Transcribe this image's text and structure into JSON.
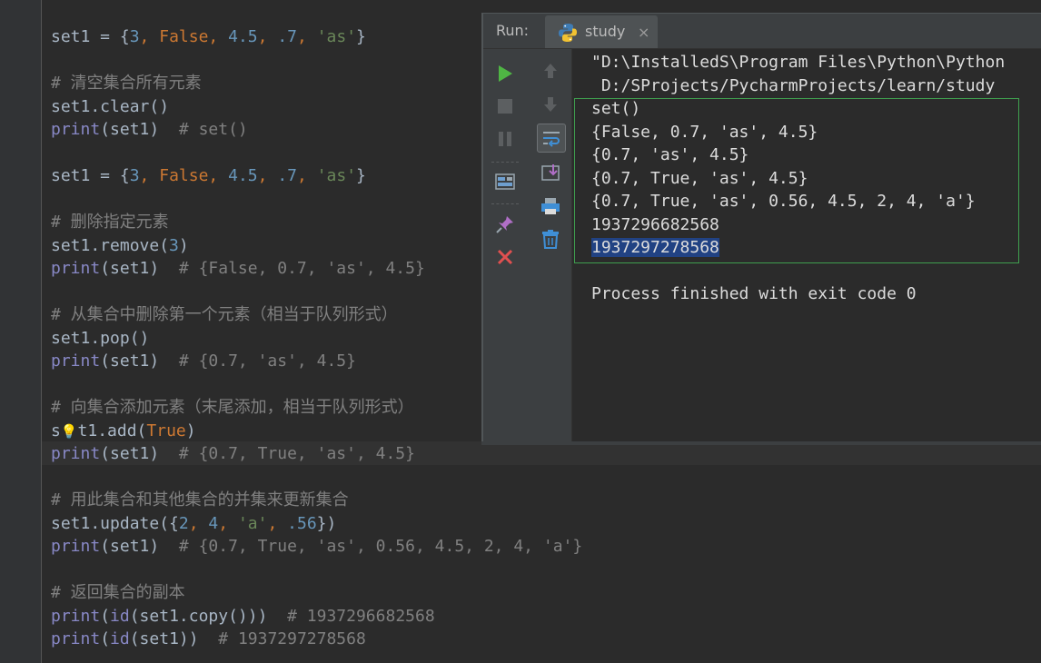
{
  "editor": {
    "lines": [
      [
        {
          "t": "set1 = {",
          "c": ""
        },
        {
          "t": "3",
          "c": "num"
        },
        {
          "t": ", ",
          "c": "kw"
        },
        {
          "t": "False",
          "c": "kw"
        },
        {
          "t": ", ",
          "c": "kw"
        },
        {
          "t": "4.5",
          "c": "num"
        },
        {
          "t": ", ",
          "c": "kw"
        },
        {
          "t": ".7",
          "c": "num"
        },
        {
          "t": ", ",
          "c": "kw"
        },
        {
          "t": "'as'",
          "c": "str"
        },
        {
          "t": "}",
          "c": ""
        }
      ],
      [],
      [
        {
          "t": "# 清空集合所有元素",
          "c": "cm"
        }
      ],
      [
        {
          "t": "set1.clear()",
          "c": ""
        }
      ],
      [
        {
          "t": "print",
          "c": "fn"
        },
        {
          "t": "(set1)  ",
          "c": ""
        },
        {
          "t": "# set()",
          "c": "cm"
        }
      ],
      [],
      [
        {
          "t": "set1 = {",
          "c": ""
        },
        {
          "t": "3",
          "c": "num"
        },
        {
          "t": ", ",
          "c": "kw"
        },
        {
          "t": "False",
          "c": "kw"
        },
        {
          "t": ", ",
          "c": "kw"
        },
        {
          "t": "4.5",
          "c": "num"
        },
        {
          "t": ", ",
          "c": "kw"
        },
        {
          "t": ".7",
          "c": "num"
        },
        {
          "t": ", ",
          "c": "kw"
        },
        {
          "t": "'as'",
          "c": "str"
        },
        {
          "t": "}",
          "c": ""
        }
      ],
      [],
      [
        {
          "t": "# 删除指定元素",
          "c": "cm"
        }
      ],
      [
        {
          "t": "set1.remove(",
          "c": ""
        },
        {
          "t": "3",
          "c": "num"
        },
        {
          "t": ")",
          "c": ""
        }
      ],
      [
        {
          "t": "print",
          "c": "fn"
        },
        {
          "t": "(set1)  ",
          "c": ""
        },
        {
          "t": "# {False, 0.7, 'as', 4.5}",
          "c": "cm"
        }
      ],
      [],
      [
        {
          "t": "# 从集合中删除第一个元素（相当于队列形式）",
          "c": "cm"
        }
      ],
      [
        {
          "t": "set1.pop()",
          "c": ""
        }
      ],
      [
        {
          "t": "print",
          "c": "fn"
        },
        {
          "t": "(set1)  ",
          "c": ""
        },
        {
          "t": "# {0.7, 'as', 4.5}",
          "c": "cm"
        }
      ],
      [],
      [
        {
          "t": "# 向集合添加元素（末尾添加，相当于队列形式）",
          "c": "cm"
        }
      ],
      [
        {
          "t": "s",
          "c": ""
        },
        {
          "t": "💡",
          "c": "bulb"
        },
        {
          "t": "t1.add(",
          "c": ""
        },
        {
          "t": "True",
          "c": "kw"
        },
        {
          "t": ")",
          "c": ""
        }
      ],
      [
        {
          "t": "print",
          "c": "fn"
        },
        {
          "t": "(set1)  ",
          "c": ""
        },
        {
          "t": "# {0.7, True, 'as', 4.5}",
          "c": "cm"
        }
      ],
      [],
      [
        {
          "t": "# 用此集合和其他集合的并集来更新集合",
          "c": "cm"
        }
      ],
      [
        {
          "t": "set1.update({",
          "c": ""
        },
        {
          "t": "2",
          "c": "num"
        },
        {
          "t": ", ",
          "c": "kw"
        },
        {
          "t": "4",
          "c": "num"
        },
        {
          "t": ", ",
          "c": "kw"
        },
        {
          "t": "'a'",
          "c": "str"
        },
        {
          "t": ", ",
          "c": "kw"
        },
        {
          "t": ".56",
          "c": "num"
        },
        {
          "t": "})",
          "c": ""
        }
      ],
      [
        {
          "t": "print",
          "c": "fn"
        },
        {
          "t": "(set1)  ",
          "c": ""
        },
        {
          "t": "# {0.7, True, 'as', 0.56, 4.5, 2, 4, 'a'}",
          "c": "cm"
        }
      ],
      [],
      [
        {
          "t": "# 返回集合的副本",
          "c": "cm"
        }
      ],
      [
        {
          "t": "print",
          "c": "fn"
        },
        {
          "t": "(",
          "c": ""
        },
        {
          "t": "id",
          "c": "fn"
        },
        {
          "t": "(set1.copy()))  ",
          "c": ""
        },
        {
          "t": "# 1937296682568",
          "c": "cm"
        }
      ],
      [
        {
          "t": "print",
          "c": "fn"
        },
        {
          "t": "(",
          "c": ""
        },
        {
          "t": "id",
          "c": "fn"
        },
        {
          "t": "(set1))  ",
          "c": ""
        },
        {
          "t": "# 1937297278568",
          "c": "cm"
        }
      ]
    ]
  },
  "run_panel": {
    "label": "Run:",
    "tab_name": "study",
    "tab_close": "×",
    "console": {
      "path_line1": "\"D:\\InstalledS\\Program Files\\Python\\Python",
      "path_line2": " D:/SProjects/PycharmProjects/learn/study",
      "outputs": [
        "set()",
        "{False, 0.7, 'as', 4.5}",
        "{0.7, 'as', 4.5}",
        "{0.7, True, 'as', 4.5}",
        "{0.7, True, 'as', 0.56, 4.5, 2, 4, 'a'}",
        "1937296682568"
      ],
      "selected_output": "1937297278568",
      "exit_message": "Process finished with exit code 0"
    }
  },
  "toolbar": {
    "icons": [
      "run-icon",
      "stop-icon",
      "pause-icon",
      "dump-threads-icon",
      "pin-tab-icon",
      "close-icon"
    ],
    "icons2": [
      "up-arrow-icon",
      "down-arrow-icon",
      "soft-wrap-icon",
      "scroll-to-end-icon",
      "print-icon",
      "trash-icon"
    ]
  },
  "colors": {
    "accent_run": "#4fb544",
    "stop_red": "#e05050",
    "selection": "#214283",
    "box_border": "#3f9f4f"
  }
}
